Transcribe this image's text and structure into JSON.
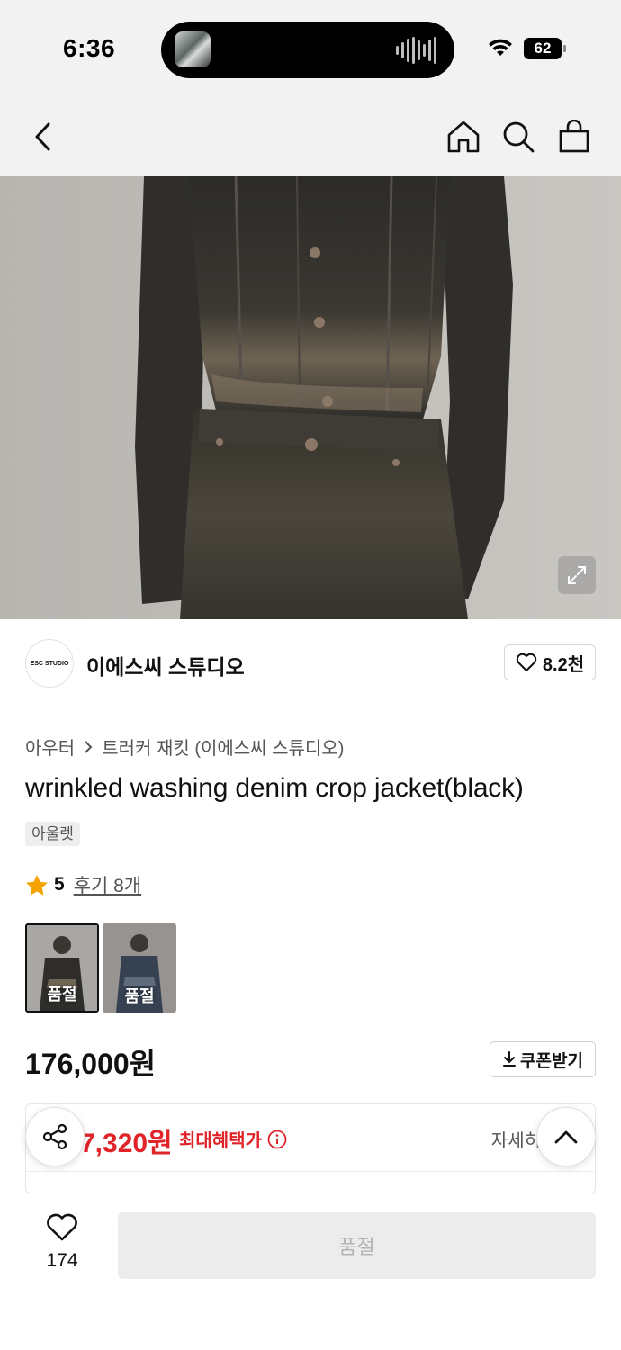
{
  "status_bar": {
    "time": "6:36",
    "battery": "62",
    "icons": [
      "wifi-icon",
      "battery-icon",
      "audio-wave-icon"
    ]
  },
  "nav": {
    "icons": [
      "back-icon",
      "home-icon",
      "search-icon",
      "shopping-bag-icon"
    ]
  },
  "hero": {
    "icons": [
      "expand-icon"
    ]
  },
  "brand": {
    "logo_text": "ESC STUDIO",
    "name": "이에스씨 스튜디오",
    "likes": "8.2천"
  },
  "breadcrumb": {
    "category": "아우터",
    "subcategory": "트러커 재킷 (이에스씨 스튜디오)"
  },
  "product": {
    "title": "wrinkled washing denim crop jacket(black)",
    "tag": "아울렛",
    "rating": "5",
    "reviews": "후기 8개",
    "options": [
      {
        "label": "품절"
      },
      {
        "label": "품절"
      }
    ],
    "price": "176,000원",
    "coupon": "쿠폰받기"
  },
  "benefit": {
    "price": "7,320원",
    "label": "최대혜택가",
    "detail": "자세히"
  },
  "bottom": {
    "wish_count": "174",
    "buy_label": "품절"
  },
  "colors": {
    "accent_red": "#e0242a",
    "star": "#f5a300",
    "header_bg": "#f2f2f2"
  }
}
